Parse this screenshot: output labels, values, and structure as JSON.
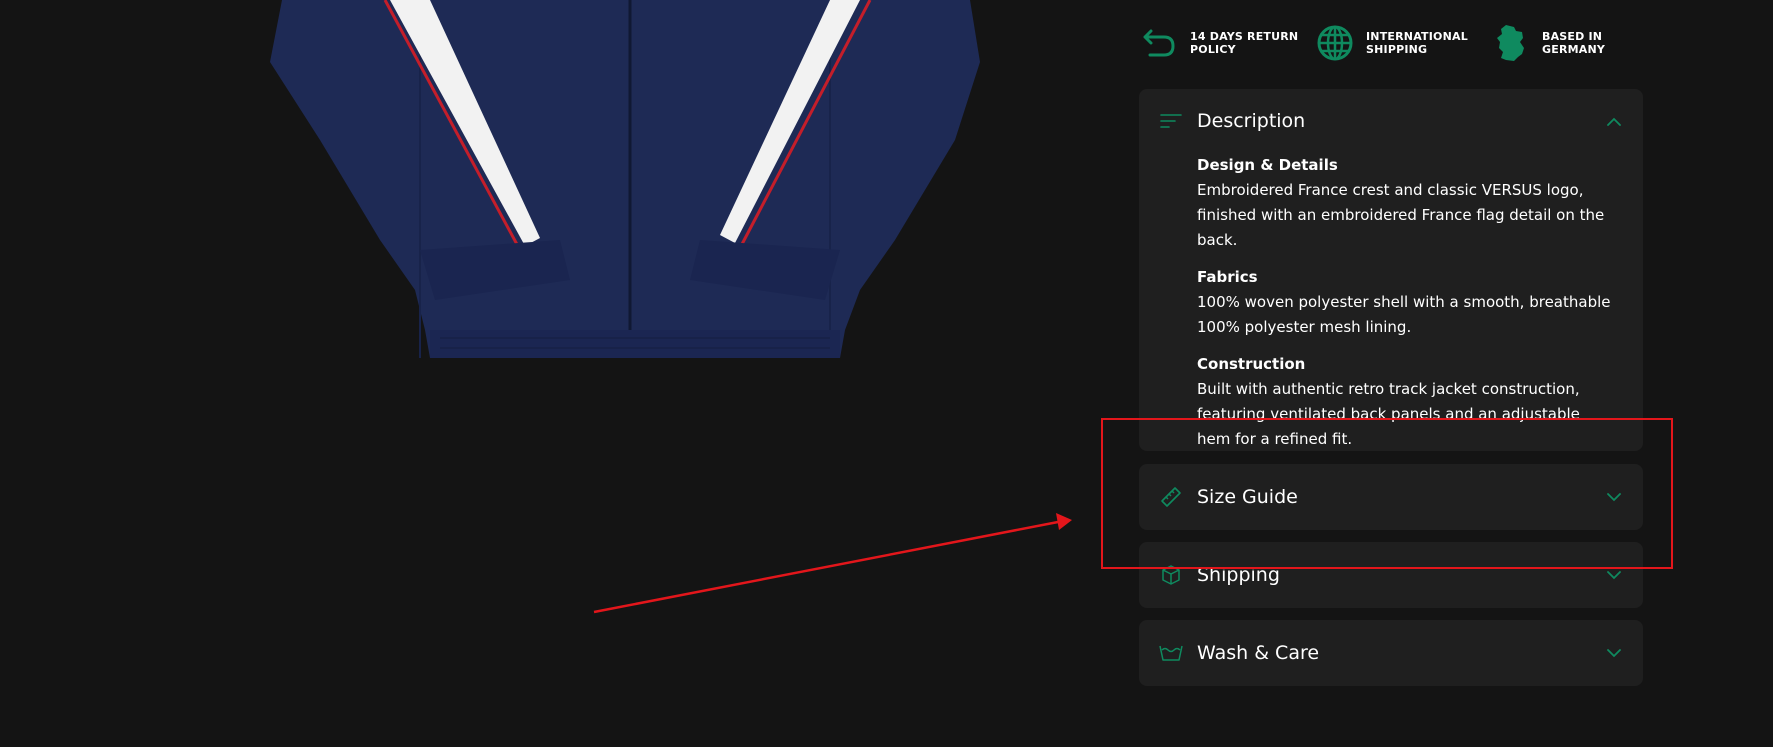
{
  "badges": [
    {
      "icon": "return-arrow-icon",
      "label": "14 DAYS RETURN POLICY"
    },
    {
      "icon": "globe-icon",
      "label": "INTERNATIONAL SHIPPING"
    },
    {
      "icon": "germany-map-icon",
      "label": "BASED IN GERMANY"
    }
  ],
  "accordion": {
    "description": {
      "title": "Description",
      "icon": "text-lines-icon",
      "expanded": true,
      "sections": [
        {
          "heading": "Design & Details",
          "text": "Embroidered France crest and classic VERSUS logo, finished with an embroidered France flag detail on the back."
        },
        {
          "heading": "Fabrics",
          "text": "100% woven polyester shell with a smooth, breathable 100% polyester mesh lining."
        },
        {
          "heading": "Construction",
          "text": "Built with authentic retro track jacket construction, featuring ventilated back panels and an adjustable hem for a refined fit."
        }
      ]
    },
    "size_guide": {
      "title": "Size Guide",
      "icon": "ruler-icon",
      "expanded": false
    },
    "shipping": {
      "title": "Shipping",
      "icon": "box-icon",
      "expanded": false
    },
    "wash_care": {
      "title": "Wash & Care",
      "icon": "wash-basin-icon",
      "expanded": false
    }
  },
  "colors": {
    "accent": "#0f8a5f",
    "background": "#141414",
    "panel": "#1f1f1f",
    "annotation": "#e3161b"
  }
}
